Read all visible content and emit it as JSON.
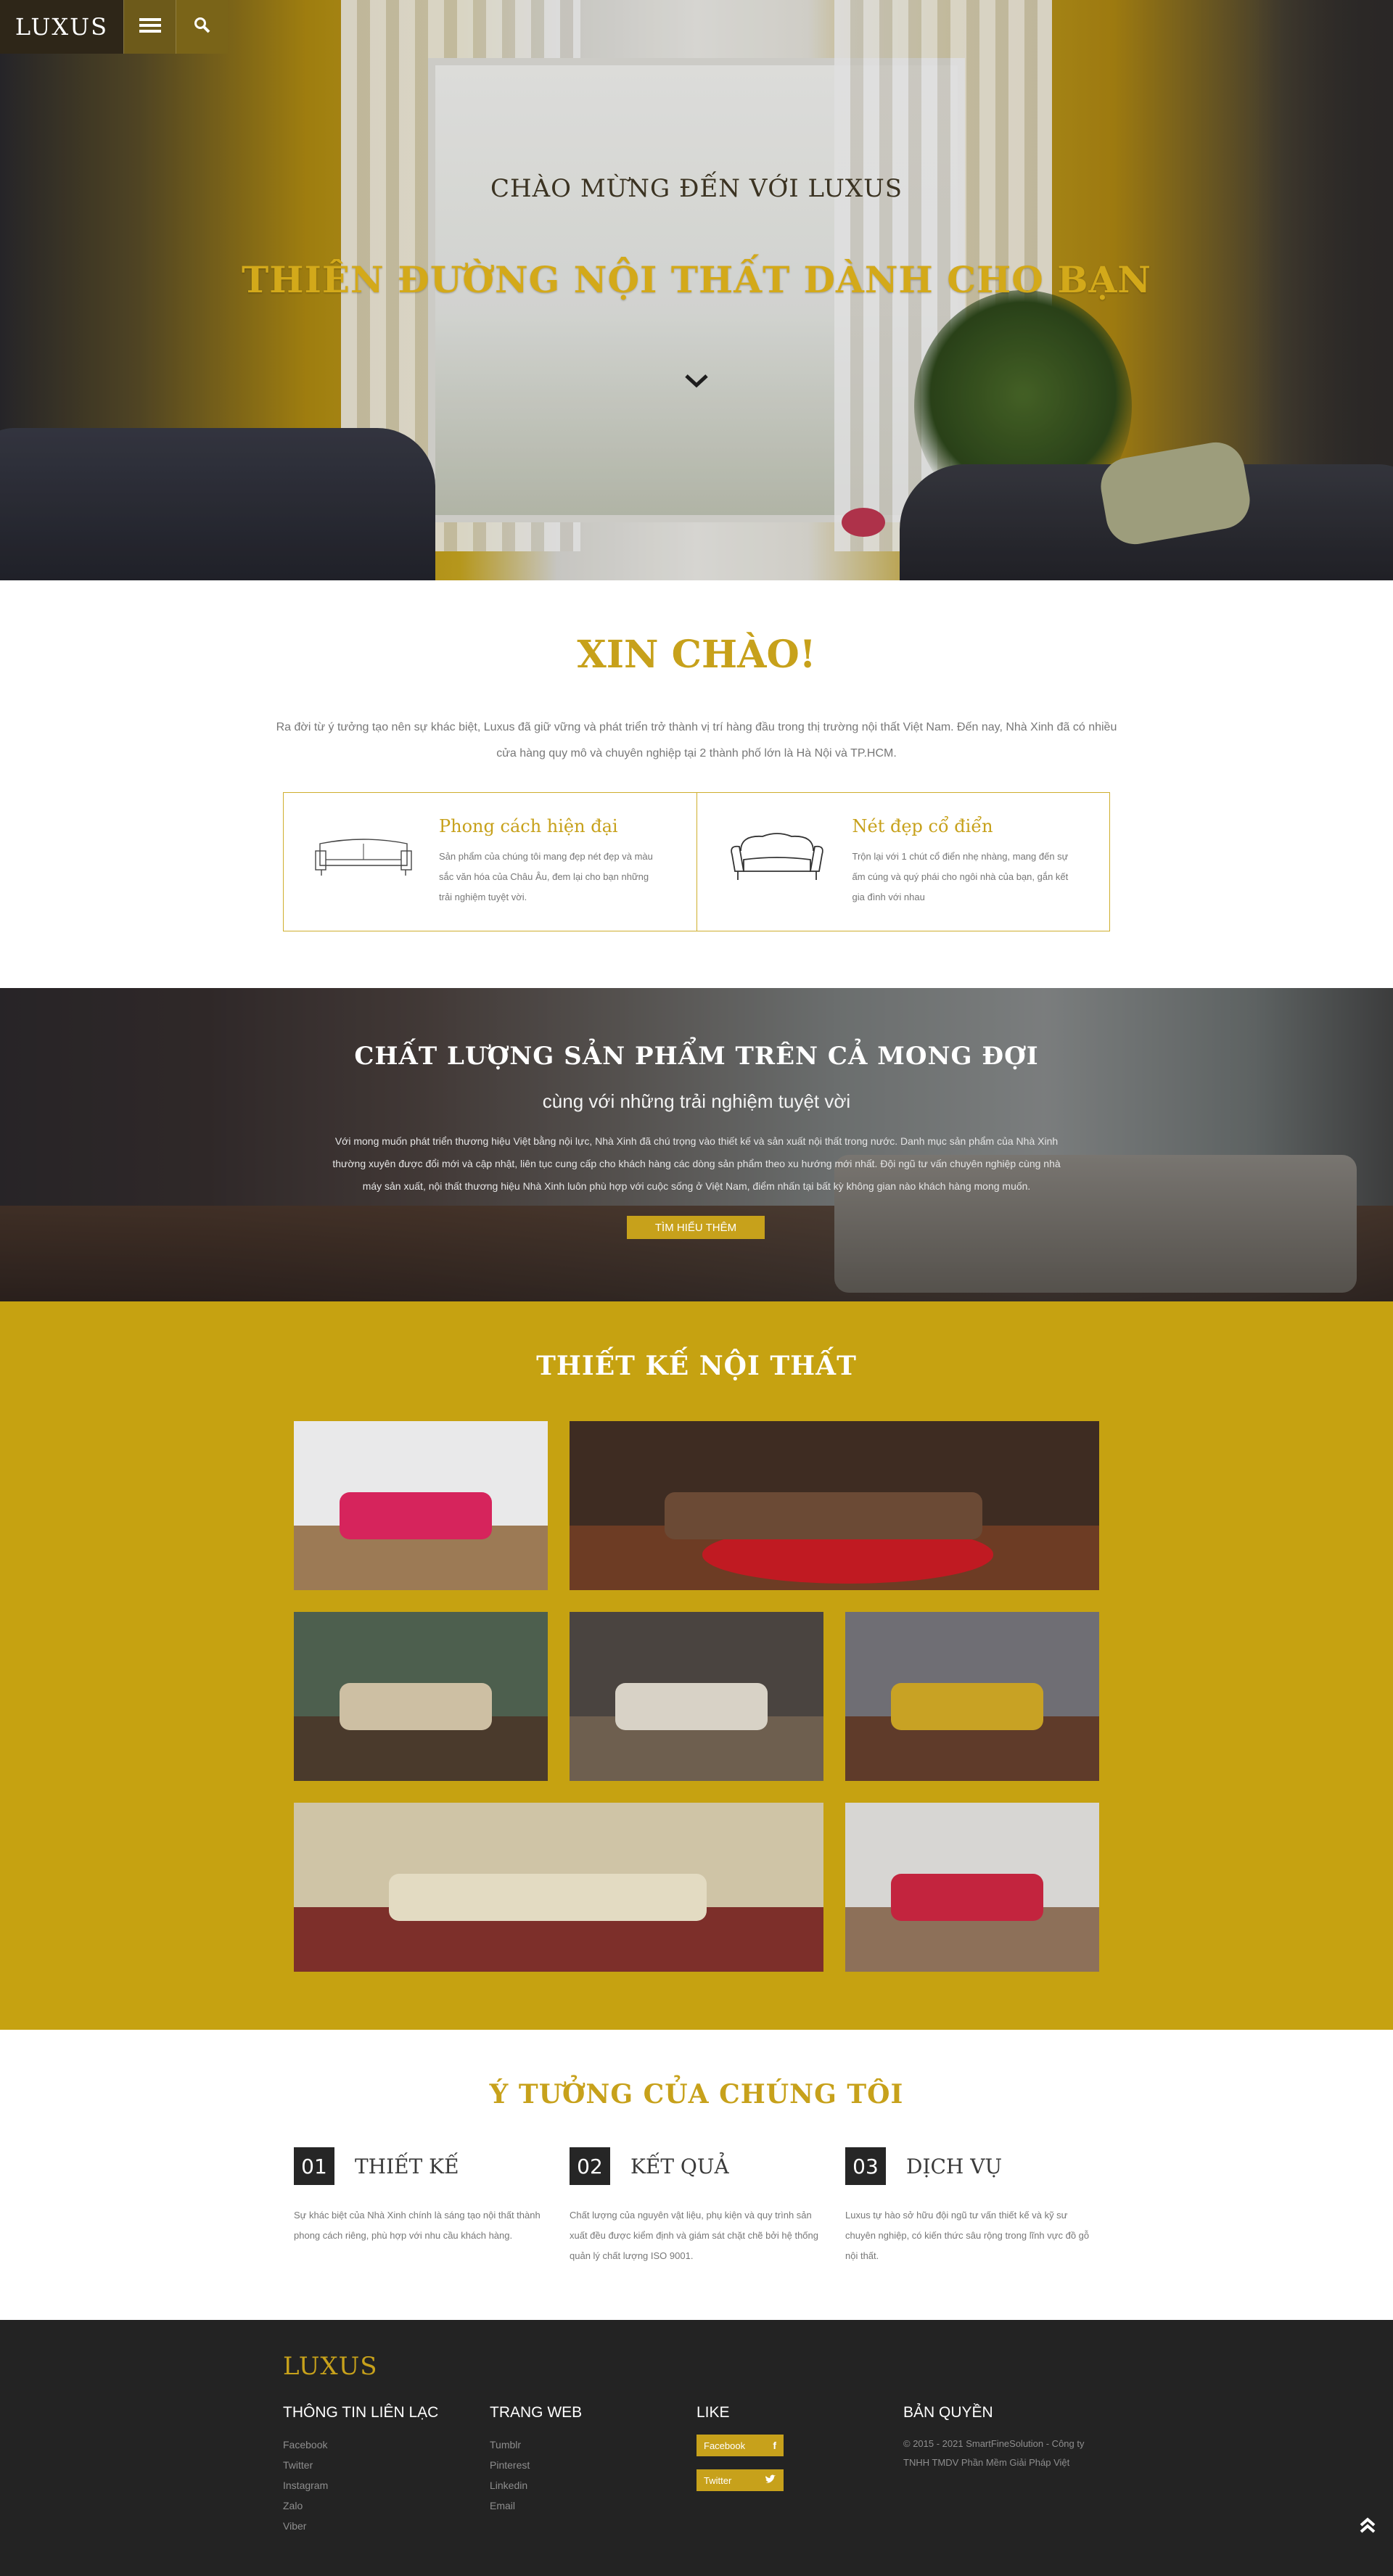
{
  "header": {
    "brand": "LUXUS",
    "menu_icon": "hamburger-menu-icon",
    "search_icon": "search-icon"
  },
  "hero": {
    "subtitle": "Chào mừng đến với Luxus",
    "title": "Thiên đường nội thất dành cho bạn",
    "scroll_icon": "chevron-down-icon"
  },
  "welcome": {
    "title": "XIN CHÀO!",
    "text": "Ra đời từ ý tưởng tạo nên sự khác biệt, Luxus đã giữ vững và phát triển trở thành vị trí hàng đầu trong thị trường nội thất Việt Nam. Đến nay, Nhà Xinh đã có nhiều cửa hàng quy mô và chuyên nghiệp tại 2 thành phố lớn là Hà Nội và TP.HCM.",
    "features": [
      {
        "title": "Phong cách hiện đại",
        "text": "Sản phẩm của chúng tôi mang đẹp nét đẹp và màu sắc văn hóa của Châu Âu, đem lại cho bạn những trải nghiệm tuyệt vời.",
        "icon": "modern-sofa-icon"
      },
      {
        "title": "Nét đẹp cổ điển",
        "text": "Trộn lại với 1 chút cổ điển nhẹ nhàng, mang đến sự ấm cúng và quý phái cho ngôi nhà của bạn, gắn kết gia đình với nhau",
        "icon": "classic-sofa-icon"
      }
    ]
  },
  "quality": {
    "title": "Chất lượng sản phẩm trên cả mong đợi",
    "subtitle": "cùng với những trải nghiệm tuyệt vời",
    "text": "Với mong muốn phát triển thương hiệu Việt bằng nội lực, Nhà Xinh đã chú trọng vào thiết kế và sản xuất nội thất trong nước. Danh mục sản phẩm của Nhà Xinh thường xuyên được đổi mới và cập nhật, liên tục cung cấp cho khách hàng các dòng sản phẩm theo xu hướng mới nhất. Đội ngũ tư vấn chuyên nghiệp cùng nhà máy sản xuất, nội thất thương hiệu Nhà Xinh luôn phù hợp với cuộc sống ở Việt Nam, điểm nhấn tại bất kỳ không gian nào khách hàng mong muốn.",
    "button": "Tìm hiểu thêm"
  },
  "gallery": {
    "title": "Thiết kế nội thất",
    "tiles": [
      {
        "name": "gallery-photo-pink-sofa-study",
        "wall": "#e9e9ea",
        "floor": "#9c7a55",
        "sofa": "#d6245c"
      },
      {
        "name": "gallery-photo-leather-sectional",
        "wall": "#3e2c22",
        "floor": "#6d3c24",
        "sofa": "#6b4a35",
        "rug": "#c01a22"
      },
      {
        "name": "gallery-photo-art-lounge",
        "wall": "#4d5f4e",
        "floor": "#4a3a2c",
        "sofa": "#cdbfa3"
      },
      {
        "name": "gallery-photo-dark-living-room",
        "wall": "#4a4440",
        "floor": "#6e5f4f",
        "sofa": "#d8d2c6"
      },
      {
        "name": "gallery-photo-yellow-sofa-room",
        "wall": "#6f6e74",
        "floor": "#5f3b2a",
        "sofa": "#c8a224"
      },
      {
        "name": "gallery-photo-beige-sofa-rug",
        "wall": "#cfc4a6",
        "floor": "#7d2f2a",
        "sofa": "#e3dbc2"
      },
      {
        "name": "gallery-photo-red-sofa-dining",
        "wall": "#d7d6d3",
        "floor": "#8d7059",
        "sofa": "#c3243e"
      }
    ]
  },
  "ideas": {
    "title": "Ý tưởng của chúng tôi",
    "items": [
      {
        "number": "01",
        "title": "Thiết kế",
        "text": "Sự khác biệt của Nhà Xinh chính là sáng tạo nội thất thành phong cách riêng, phù hợp với nhu cầu khách hàng."
      },
      {
        "number": "02",
        "title": "Kết quả",
        "text": "Chất lượng của nguyên vật liệu, phụ kiện và quy trình sản xuất đều được kiểm định và giám sát chặt chẽ bởi hệ thống quản lý chất lượng ISO 9001."
      },
      {
        "number": "03",
        "title": "Dịch vụ",
        "text": "Luxus tự hào sở hữu đội ngũ tư vấn thiết kế và kỹ sư chuyên nghiệp, có kiến thức sâu rộng trong lĩnh vực đồ gỗ nội thất."
      }
    ]
  },
  "footer": {
    "brand": "LUXUS",
    "contact": {
      "title": "Thông tin liên lạc",
      "links": [
        "Facebook",
        "Twitter",
        "Instagram",
        "Zalo",
        "Viber"
      ]
    },
    "web": {
      "title": "Trang web",
      "links": [
        "Tumblr",
        "Pinterest",
        "Linkedin",
        "Email"
      ]
    },
    "like": {
      "title": "Like",
      "buttons": [
        {
          "label": "Facebook",
          "icon": "f"
        },
        {
          "label": "Twitter",
          "icon": "bird"
        }
      ]
    },
    "copyright": {
      "title": "Bản quyền",
      "text": "© 2015 - 2021 SmartFineSolution - Công ty TNHH TMDV Phần Mềm Giải Pháp Việt"
    },
    "to_top_icon": "double-chevron-up-icon"
  },
  "colors": {
    "accent": "#c7a11b",
    "gallery_bg": "#c6a211",
    "footer_bg": "#232323"
  }
}
